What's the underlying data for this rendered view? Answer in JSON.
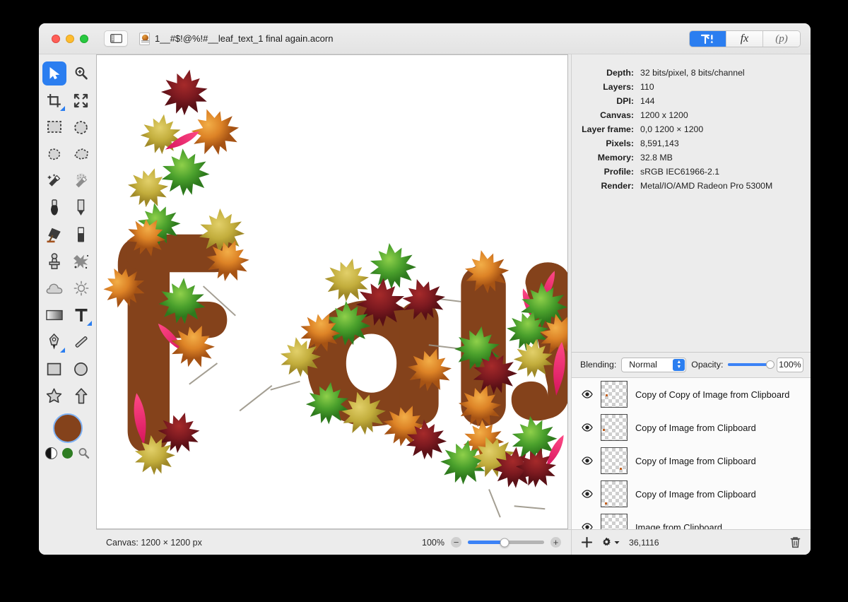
{
  "window": {
    "title": "1__#$!@%!#__leaf_text_1 final again.acorn",
    "traffic_lights": [
      "close-button",
      "minimize-button",
      "maximize-button"
    ],
    "sidebar_toggle": "sidebar-toggle-icon"
  },
  "inspector_tabs": [
    {
      "id": "info",
      "label": "",
      "icon": "tools-info-icon",
      "active": true
    },
    {
      "id": "fx",
      "label": "fx",
      "icon": "fx-icon",
      "active": false
    },
    {
      "id": "presets",
      "label": "(p)",
      "icon": "presets-icon",
      "active": false
    }
  ],
  "info": {
    "rows": [
      {
        "label": "Depth:",
        "value": "32 bits/pixel, 8 bits/channel"
      },
      {
        "label": "Layers:",
        "value": "110"
      },
      {
        "label": "DPI:",
        "value": "144"
      },
      {
        "label": "Canvas:",
        "value": "1200 x 1200"
      },
      {
        "label": "Layer frame:",
        "value": "0,0 1200 × 1200"
      },
      {
        "label": "Pixels:",
        "value": "8,591,143"
      },
      {
        "label": "Memory:",
        "value": "32.8 MB"
      },
      {
        "label": "Profile:",
        "value": "sRGB IEC61966-2.1"
      },
      {
        "label": "Render:",
        "value": "Metal/IO/AMD Radeon Pro 5300M"
      }
    ]
  },
  "blending": {
    "label": "Blending:",
    "mode": "Normal",
    "opacity_label": "Opacity:",
    "opacity_value": "100%",
    "opacity_percent": 100
  },
  "layers": {
    "items": [
      {
        "name": "Copy of Copy of Image from Clipboard",
        "visible": true
      },
      {
        "name": "Copy of Image from Clipboard",
        "visible": true
      },
      {
        "name": "Copy of Image from Clipboard",
        "visible": true
      },
      {
        "name": "Copy of Image from Clipboard",
        "visible": true
      },
      {
        "name": "Image from Clipboard",
        "visible": true
      }
    ],
    "footer": {
      "add": "add-layer-icon",
      "gear": "layer-actions-gear-icon",
      "coords": "36,1116",
      "trash": "delete-layer-icon"
    }
  },
  "statusbar": {
    "canvas_text": "Canvas: 1200 × 1200 px",
    "zoom_text": "100%",
    "zoom_percent": 48
  },
  "tools": [
    {
      "name": "move-tool",
      "icon": "cursor-arrow-icon",
      "selected": true
    },
    {
      "name": "zoom-tool",
      "icon": "magnifier-plus-icon",
      "selected": false
    },
    {
      "name": "crop-tool",
      "icon": "crop-icon",
      "selected": false
    },
    {
      "name": "transform-tool",
      "icon": "arrows-expand-icon",
      "selected": false
    },
    {
      "name": "rectangular-select-tool",
      "icon": "marquee-rect-icon",
      "selected": false
    },
    {
      "name": "elliptical-select-tool",
      "icon": "marquee-ellipse-icon",
      "selected": false
    },
    {
      "name": "lasso-tool",
      "icon": "lasso-icon",
      "selected": false
    },
    {
      "name": "polygon-lasso-tool",
      "icon": "polygon-lasso-icon",
      "selected": false
    },
    {
      "name": "magic-wand-tool",
      "icon": "magic-wand-icon",
      "selected": false
    },
    {
      "name": "instant-alpha-tool",
      "icon": "magic-wand-dots-icon",
      "selected": false
    },
    {
      "name": "brush-tool",
      "icon": "brush-icon",
      "selected": false
    },
    {
      "name": "pencil-tool",
      "icon": "pencil-icon",
      "selected": false
    },
    {
      "name": "paint-bucket-tool",
      "icon": "paint-bucket-icon",
      "selected": false
    },
    {
      "name": "eraser-tool",
      "icon": "eraser-icon",
      "selected": false
    },
    {
      "name": "clone-stamp-tool",
      "icon": "clone-stamp-icon",
      "selected": false
    },
    {
      "name": "smudge-tool",
      "icon": "smudge-icon",
      "selected": false
    },
    {
      "name": "dodge-burn-tool",
      "icon": "cloud-icon",
      "selected": false
    },
    {
      "name": "brightness-tool",
      "icon": "sun-icon",
      "selected": false
    },
    {
      "name": "gradient-tool",
      "icon": "gradient-icon",
      "selected": false
    },
    {
      "name": "text-tool",
      "icon": "text-t-icon",
      "selected": false
    },
    {
      "name": "pen-tool",
      "icon": "pen-nib-icon",
      "selected": false
    },
    {
      "name": "line-tool",
      "icon": "line-icon",
      "selected": false
    },
    {
      "name": "rectangle-shape-tool",
      "icon": "rectangle-icon",
      "selected": false
    },
    {
      "name": "ellipse-shape-tool",
      "icon": "ellipse-icon",
      "selected": false
    },
    {
      "name": "star-shape-tool",
      "icon": "star-icon",
      "selected": false
    },
    {
      "name": "arrow-shape-tool",
      "icon": "arrow-up-icon",
      "selected": false
    }
  ],
  "colors": {
    "foreground": "#84421b",
    "accent": "#2b7ef0",
    "secondary_swatch": "#2f7d23",
    "window_chrome": "#ececec"
  },
  "artwork": {
    "word": "Fall",
    "letter_color": "#84421b",
    "description": "The word Fall in thick rounded brown letters decorated with autumn maple leaves",
    "leaf_colors": [
      "#4aa02c",
      "#b9a93a",
      "#d9832a",
      "#8e1c22",
      "#e8316f"
    ]
  }
}
